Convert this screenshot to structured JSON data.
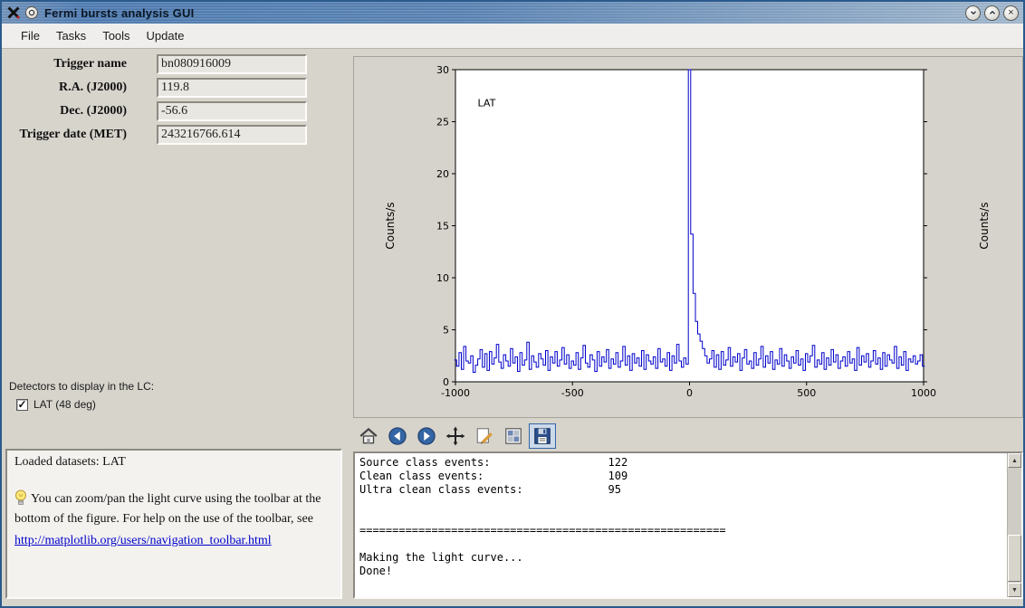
{
  "window": {
    "title": "Fermi bursts analysis GUI"
  },
  "menu": {
    "items": [
      "File",
      "Tasks",
      "Tools",
      "Update"
    ]
  },
  "form": {
    "fields": [
      {
        "label": "Trigger name",
        "value": "bn080916009"
      },
      {
        "label": "R.A. (J2000)",
        "value": "119.8"
      },
      {
        "label": "Dec. (J2000)",
        "value": "-56.6"
      },
      {
        "label": "Trigger date (MET)",
        "value": "243216766.614"
      }
    ]
  },
  "detectors": {
    "heading": "Detectors to display in the LC:",
    "items": [
      {
        "label": "LAT (48 deg)",
        "checked": true
      }
    ]
  },
  "info_box": {
    "loaded_datasets": "Loaded datasets: LAT",
    "tip_text": "You can zoom/pan the light curve using the toolbar at the bottom of the figure. For help on the use of the toolbar, see",
    "link_text": "http://matplotlib.org/users/navigation_toolbar.html",
    "link_href": "http://matplotlib.org/users/navigation_toolbar.html"
  },
  "mpl_toolbar": {
    "buttons": [
      "home",
      "back",
      "forward",
      "pan",
      "zoom",
      "subplots",
      "save"
    ],
    "active": "save"
  },
  "console": {
    "lines": [
      "Source class events:                  122",
      "Clean class events:                   109",
      "Ultra clean class events:             95",
      "",
      "",
      "========================================================",
      "",
      "Making the light curve...",
      "Done!"
    ]
  },
  "colors": {
    "titlebar_blue": "#4a79b0",
    "window_bg": "#d7d4cc",
    "link": "#0000cc",
    "line": "#0000cc"
  },
  "chart_data": {
    "type": "line",
    "title": "",
    "xlabel": "",
    "ylabel": "Counts/s",
    "ylabel_right": "Counts/s",
    "xlim": [
      -1000,
      1000
    ],
    "ylim": [
      0,
      30
    ],
    "xticks": [
      -1000,
      -500,
      0,
      500,
      1000
    ],
    "yticks": [
      0,
      5,
      10,
      15,
      20,
      25,
      30
    ],
    "grid": false,
    "legend": false,
    "line_color": "#0000cc",
    "annotations": [
      {
        "text": "LAT",
        "x": -905,
        "y": 26.5
      }
    ],
    "series": [
      {
        "name": "LAT",
        "x_start": -1000,
        "x_step": 10,
        "values": [
          2.1,
          1.5,
          2.8,
          1.2,
          3.4,
          2.0,
          1.8,
          2.5,
          0.9,
          1.6,
          2.2,
          3.1,
          1.4,
          2.7,
          1.1,
          2.9,
          1.7,
          2.3,
          3.6,
          1.9,
          1.3,
          2.6,
          2.0,
          1.5,
          3.2,
          1.8,
          2.4,
          1.0,
          2.8,
          1.6,
          2.1,
          3.8,
          1.2,
          2.5,
          1.9,
          1.4,
          2.7,
          2.2,
          1.6,
          3.0,
          1.1,
          2.4,
          1.8,
          2.9,
          1.5,
          2.1,
          3.3,
          1.7,
          2.6,
          1.3,
          2.0,
          1.6,
          2.8,
          1.2,
          2.3,
          3.5,
          1.8,
          1.4,
          2.6,
          2.1,
          1.0,
          2.9,
          1.5,
          2.4,
          1.9,
          3.1,
          1.3,
          2.2,
          1.7,
          2.8,
          1.4,
          2.0,
          3.4,
          1.6,
          2.5,
          1.1,
          2.7,
          1.8,
          2.3,
          1.5,
          3.0,
          1.2,
          2.6,
          2.0,
          1.7,
          2.4,
          1.3,
          3.2,
          1.9,
          2.2,
          1.5,
          2.8,
          1.1,
          2.5,
          1.8,
          3.6,
          2.0,
          1.4,
          2.3,
          1.7,
          30,
          14.2,
          8.5,
          5.8,
          4.6,
          3.9,
          3.2,
          2.5,
          1.8,
          2.2,
          3.0,
          1.4,
          2.6,
          1.2,
          2.9,
          1.6,
          2.1,
          3.3,
          1.5,
          2.4,
          1.9,
          2.7,
          1.1,
          2.3,
          3.1,
          1.7,
          2.0,
          1.3,
          2.8,
          1.6,
          2.2,
          3.4,
          1.4,
          2.5,
          1.8,
          2.9,
          1.2,
          2.1,
          1.7,
          3.2,
          1.5,
          2.6,
          2.0,
          1.3,
          2.4,
          1.8,
          3.0,
          1.6,
          2.2,
          1.1,
          2.7,
          1.9,
          2.5,
          3.5,
          1.4,
          2.1,
          1.7,
          2.8,
          1.2,
          2.3,
          1.6,
          3.1,
          1.9,
          2.6,
          1.3,
          2.0,
          2.4,
          1.5,
          2.9,
          1.8,
          2.2,
          1.1,
          3.3,
          1.6,
          2.5,
          1.9,
          2.7,
          1.4,
          2.0,
          3.0,
          1.7,
          2.3,
          1.2,
          2.8,
          1.5,
          2.6,
          2.1,
          1.8,
          3.4,
          1.3,
          2.4,
          1.6,
          2.9,
          1.1,
          2.2,
          1.9,
          2.5,
          1.7,
          2.0,
          2.6,
          1.5
        ]
      }
    ]
  }
}
